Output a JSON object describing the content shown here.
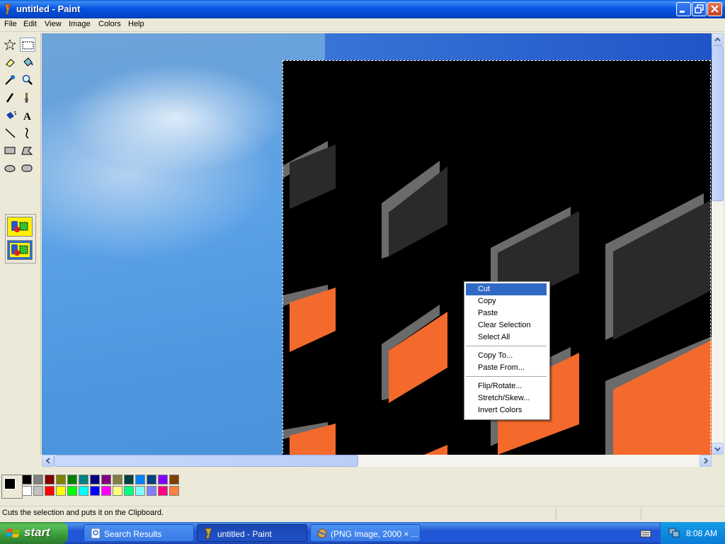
{
  "window": {
    "title": "untitled - Paint",
    "controls": [
      "minimize",
      "maximize",
      "close"
    ]
  },
  "menubar": {
    "items": [
      "File",
      "Edit",
      "View",
      "Image",
      "Colors",
      "Help"
    ]
  },
  "toolbox": {
    "tools": [
      {
        "name": "free-form-select",
        "icon": "star-select-icon"
      },
      {
        "name": "select",
        "icon": "rect-select-icon",
        "active": true
      },
      {
        "name": "eraser",
        "icon": "eraser-icon"
      },
      {
        "name": "fill",
        "icon": "paint-bucket-icon"
      },
      {
        "name": "pick-color",
        "icon": "eyedropper-icon"
      },
      {
        "name": "magnifier",
        "icon": "magnifier-icon"
      },
      {
        "name": "pencil",
        "icon": "pencil-icon"
      },
      {
        "name": "brush",
        "icon": "brush-icon"
      },
      {
        "name": "airbrush",
        "icon": "airbrush-icon"
      },
      {
        "name": "text",
        "icon": "text-icon",
        "label": "A"
      },
      {
        "name": "line",
        "icon": "line-icon"
      },
      {
        "name": "curve",
        "icon": "curve-icon"
      },
      {
        "name": "rectangle",
        "icon": "rectangle-icon"
      },
      {
        "name": "polygon",
        "icon": "polygon-icon"
      },
      {
        "name": "ellipse",
        "icon": "ellipse-icon"
      },
      {
        "name": "rounded-rectangle",
        "icon": "rounded-rect-icon"
      }
    ]
  },
  "context_menu": {
    "items": [
      "Cut",
      "Copy",
      "Paste",
      "Clear Selection",
      "Select All"
    ],
    "group2": [
      "Copy To...",
      "Paste From..."
    ],
    "group3": [
      "Flip/Rotate...",
      "Stretch/Skew...",
      "Invert Colors"
    ],
    "highlighted": "Cut"
  },
  "palette": {
    "foreground": "#000000",
    "background": "#ffffff",
    "row1": [
      "#000000",
      "#808080",
      "#800000",
      "#808000",
      "#008000",
      "#008080",
      "#000080",
      "#800080",
      "#808040",
      "#004040",
      "#0080ff",
      "#004080",
      "#8000ff",
      "#804000"
    ],
    "row2": [
      "#ffffff",
      "#c0c0c0",
      "#ff0000",
      "#ffff00",
      "#00ff00",
      "#00ffff",
      "#0000ff",
      "#ff00ff",
      "#ffff80",
      "#00ff80",
      "#80ffff",
      "#8080ff",
      "#ff0080",
      "#ff8040"
    ]
  },
  "status": {
    "text": "Cuts the selection and puts it on the Clipboard."
  },
  "taskbar": {
    "start_label": "start",
    "buttons": [
      {
        "label": "Search Results",
        "icon": "search-results-icon",
        "active": false
      },
      {
        "label": "untitled - Paint",
        "icon": "paint-icon",
        "active": true
      },
      {
        "label": "(PNG Image, 2000 × ...",
        "icon": "browser-icon",
        "active": false
      }
    ],
    "clock": "8:08 AM"
  }
}
